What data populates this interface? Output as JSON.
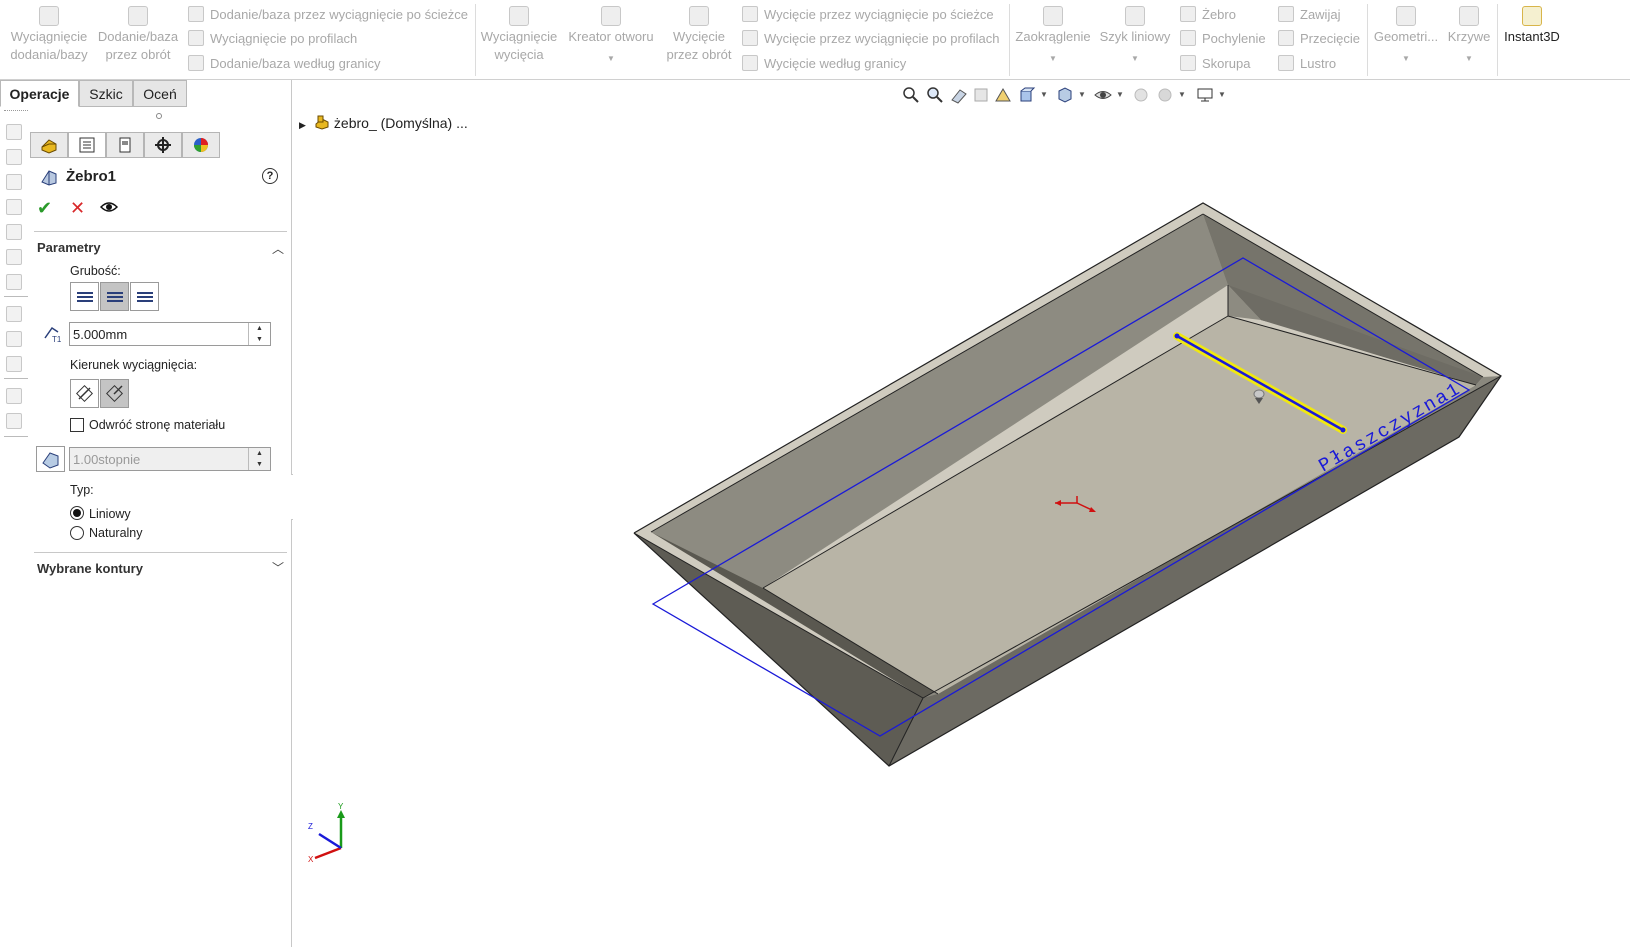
{
  "ribbon": {
    "extrude_boss": "Wyciągnięcie\ndodania/bazy",
    "revolve_boss": "Dodanie/baza\nprzez obrót",
    "swept_boss": "Dodanie/baza przez wyciągnięcie po ścieżce",
    "lofted_boss": "Wyciągnięcie po profilach",
    "boundary_boss": "Dodanie/baza według granicy",
    "extruded_cut": "Wyciągnięcie\nwycięcia",
    "hole_wizard": "Kreator otworu",
    "revolved_cut": "Wycięcie\nprzez obrót",
    "swept_cut": "Wycięcie przez wyciągnięcie po ścieżce",
    "lofted_cut": "Wycięcie przez wyciągnięcie po profilach",
    "boundary_cut": "Wycięcie według granicy",
    "fillet": "Zaokrąglenie",
    "linear_pattern": "Szyk liniowy",
    "rib": "Żebro",
    "draft": "Pochylenie",
    "shell": "Skorupa",
    "wrap": "Zawijaj",
    "intersect": "Przecięcie",
    "mirror": "Lustro",
    "reference_geometry": "Geometri...",
    "curves": "Krzywe",
    "instant3d": "Instant3D"
  },
  "tabs": [
    "Operacje",
    "Szkic",
    "Oceń"
  ],
  "property_manager": {
    "title": "Żebro1",
    "help": "?",
    "section_parameters": "Parametry",
    "thickness_label": "Grubość:",
    "thickness_value": "5.000mm",
    "direction_label": "Kierunek wyciągnięcia:",
    "flip_material_label": "Odwróć stronę materiału",
    "flip_material_checked": false,
    "draft_value": "1.00stopnie",
    "type_label": "Typ:",
    "type_options": [
      "Liniowy",
      "Naturalny"
    ],
    "type_selected": "Liniowy",
    "section_contours": "Wybrane kontury"
  },
  "viewport": {
    "tree_root": "żebro_ (Domyślna) ...",
    "plane_label": "Płaszczyzna1",
    "triad": {
      "x": "X",
      "y": "Y",
      "z": "Z"
    }
  },
  "colors": {
    "accent_blue": "#1a1ad8",
    "rib_yellow": "#f0e810",
    "ok_green": "#2a9a2a",
    "cancel_red": "#d8282a"
  }
}
